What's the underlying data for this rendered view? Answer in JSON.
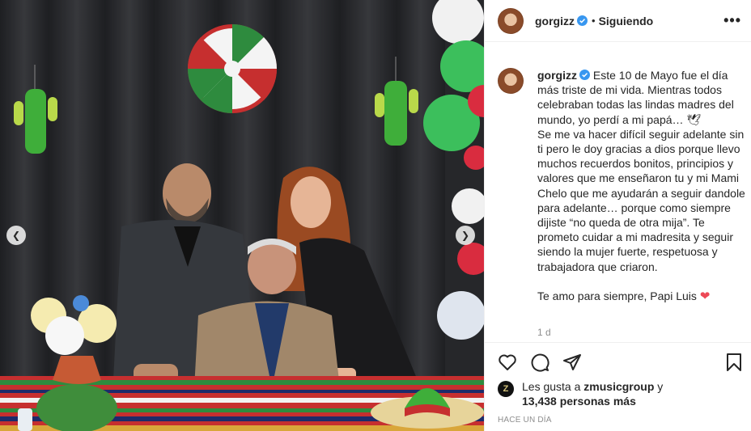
{
  "post": {
    "username": "gorgizz",
    "follow_status": "Siguiendo",
    "more_label": "•••"
  },
  "caption": {
    "username": "gorgizz",
    "text": "Este 10 de Mayo fue el día más triste de mi vida. Mientras todos celebraban todas las lindas madres del mundo, yo perdí a mi papá… 🕊\nSe me va hacer difícil seguir adelante sin ti pero le doy gracias a dios porque llevo muchos recuerdos bonitos, principios y valores que me enseñaron tu y mi Mami Chelo que me ayudarán a seguir dandole para adelante… porque como siempre dijiste “no queda de otra mija”. Te prometo cuidar a mi madresita y seguir siendo la mujer fuerte, respetuosa y trabajadora que criaron.",
    "closing": "Te amo para siempre, Papi Luis",
    "closing_emoji": "❤",
    "relative_time": "1 d"
  },
  "likes": {
    "prefix": "Les gusta a",
    "liker": "zmusicgroup",
    "suffix": "y",
    "count": "13,438 personas más"
  },
  "posted_ago": "HACE UN DÍA",
  "icons": {
    "verified": "verified-badge-icon",
    "like": "heart-outline-icon",
    "comment": "comment-icon",
    "share": "paper-plane-icon",
    "save": "bookmark-icon",
    "prev": "chevron-left-icon",
    "next": "chevron-right-icon"
  },
  "colors": {
    "verified_blue": "#3897f0",
    "heart_red": "#ed4956",
    "muted_text": "#8e8e8e",
    "border": "#efefef"
  }
}
